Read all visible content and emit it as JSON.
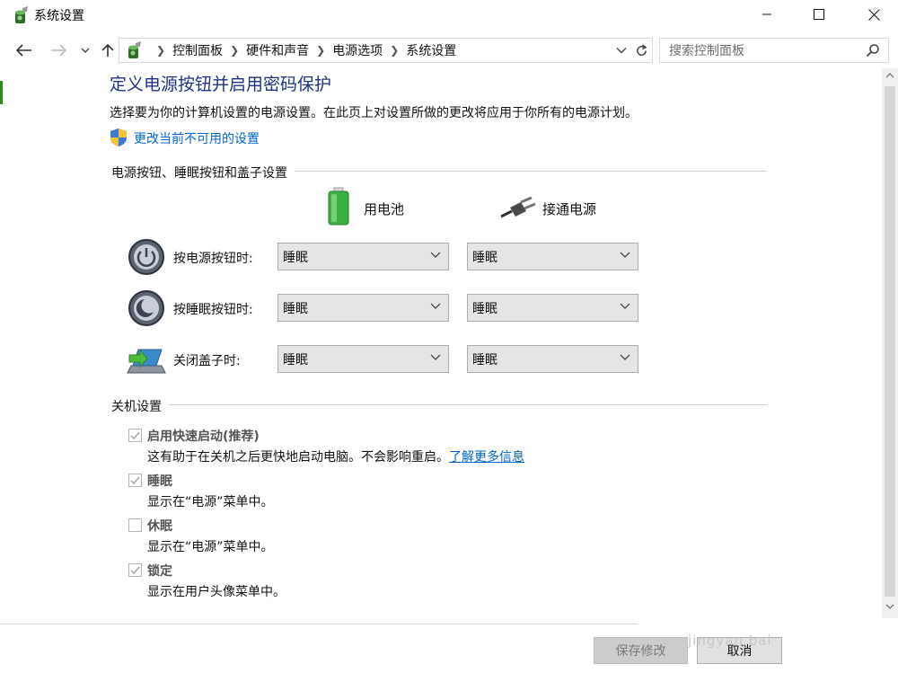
{
  "window": {
    "title": "系统设置",
    "minimize_glyph": "—",
    "maximize_glyph": "☐",
    "close_glyph": "✕"
  },
  "nav": {
    "back_glyph": "←",
    "forward_glyph": "→",
    "recent_glyph": "⌄",
    "up_glyph": "↑",
    "breadcrumbs": [
      "控制面板",
      "硬件和声音",
      "电源选项",
      "系统设置"
    ],
    "search_placeholder": "搜索控制面板"
  },
  "header": {
    "title": "定义电源按钮并启用密码保护",
    "description": "选择要为你的计算机设置的电源设置。在此页上对设置所做的更改将应用于你所有的电源计划。",
    "change_link": "更改当前不可用的设置"
  },
  "power_section": {
    "label": "电源按钮、睡眠按钮和盖子设置",
    "col_battery": "用电池",
    "col_plugged": "接通电源",
    "rows": [
      {
        "label": "按电源按钮时:",
        "battery": "睡眠",
        "plugged": "睡眠"
      },
      {
        "label": "按睡眠按钮时:",
        "battery": "睡眠",
        "plugged": "睡眠"
      },
      {
        "label": "关闭盖子时:",
        "battery": "睡眠",
        "plugged": "睡眠"
      }
    ]
  },
  "shutdown_section": {
    "label": "关机设置",
    "options": [
      {
        "label": "启用快速启动(推荐)",
        "desc": "这有助于在关机之后更快地启动电脑。不会影响重启。",
        "link": "了解更多信息",
        "checked": true
      },
      {
        "label": "睡眠",
        "desc": "显示在“电源”菜单中。",
        "checked": true
      },
      {
        "label": "休眠",
        "desc": "显示在“电源”菜单中。",
        "checked": false
      },
      {
        "label": "锁定",
        "desc": "显示在用户头像菜单中。",
        "checked": true
      }
    ]
  },
  "footer": {
    "save_label": "保存修改",
    "cancel_label": "取消"
  },
  "watermark": "jingyan bai",
  "colors": {
    "title_blue": "#1e3287",
    "link_blue": "#0066cc",
    "battery_green": "#3cb043"
  }
}
